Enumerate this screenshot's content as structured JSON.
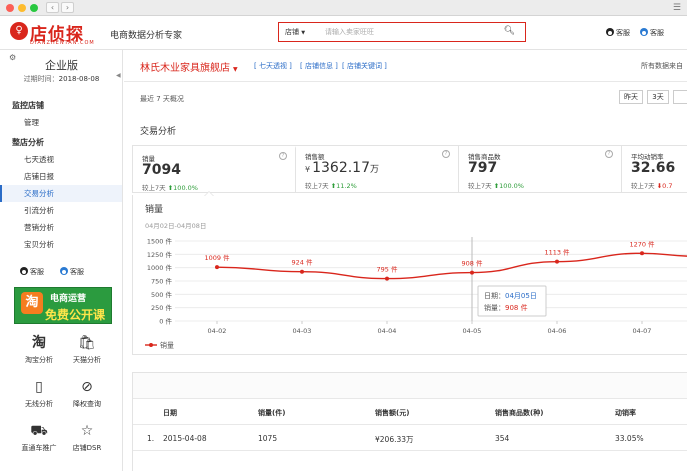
{
  "header": {
    "logo_text": "店侦探",
    "logo_sub": "DIANZHENTAN.COM",
    "slogan": "电商数据分析专家",
    "search_category": "店铺",
    "search_placeholder": "请输入卖家旺旺",
    "service_1": "客服",
    "service_2": "客服"
  },
  "sidebar": {
    "edition": "企业版",
    "expire_label": "过期时间：",
    "expire_date": "2018-08-08",
    "sections": [
      {
        "title": "监控店铺",
        "items": [
          "管理"
        ]
      },
      {
        "title": "整店分析",
        "items": [
          "七天透视",
          "店铺日报",
          "交易分析",
          "引流分析",
          "营销分析",
          "宝贝分析"
        ]
      }
    ],
    "active_item": "交易分析",
    "service_1": "客服",
    "service_2": "客服",
    "banner_line1": "电商运营",
    "banner_line2": "免费公开课",
    "banner_icon": "淘",
    "tools": [
      {
        "label": "淘宝分析",
        "icon": "taobao-icon"
      },
      {
        "label": "天猫分析",
        "icon": "tmall-icon"
      },
      {
        "label": "无线分析",
        "icon": "mobile-icon"
      },
      {
        "label": "降权查询",
        "icon": "ban-icon"
      },
      {
        "label": "直通车推广",
        "icon": "car-icon"
      },
      {
        "label": "店铺DSR",
        "icon": "star-icon"
      }
    ]
  },
  "main": {
    "shop_name": "林氏木业家具旗舰店",
    "links": [
      "[ 七天透视 ]",
      "[ 店铺信息 ]",
      "[ 店铺关键词 ]"
    ],
    "note": "所有数据来自",
    "overview": "最近 7 天概况",
    "range_buttons": [
      "昨天",
      "3天"
    ],
    "section_title": "交易分析"
  },
  "cards": [
    {
      "label": "销量",
      "prefix": "",
      "value": "7094",
      "unit": "",
      "cmp_label": "较上7天",
      "dir": "up",
      "cmp": "100.0%"
    },
    {
      "label": "销售额",
      "prefix": "¥",
      "value": "1362.17",
      "unit": "万",
      "cmp_label": "较上7天",
      "dir": "up",
      "cmp": "11.2%"
    },
    {
      "label": "销售商品数",
      "prefix": "",
      "value": "797",
      "unit": "",
      "cmp_label": "较上7天",
      "dir": "up",
      "cmp": "100.0%"
    },
    {
      "label": "平均动销率",
      "prefix": "",
      "value": "32.66",
      "unit": "",
      "cmp_label": "较上7天",
      "dir": "down",
      "cmp": "0.7"
    }
  ],
  "chart_data": {
    "type": "line",
    "title": "销量",
    "subtitle": "04月02日-04月08日",
    "categories": [
      "04-02",
      "04-03",
      "04-04",
      "04-05",
      "04-06",
      "04-07"
    ],
    "series": [
      {
        "name": "销量",
        "values": [
          1009,
          924,
          795,
          908,
          1113,
          1270
        ],
        "point_labels": [
          "1009 件",
          "924 件",
          "795 件",
          "908 件",
          "1113 件",
          "1270 件"
        ]
      }
    ],
    "ylim": [
      0,
      1500
    ],
    "yticks": [
      "0 件",
      "250 件",
      "500 件",
      "750 件",
      "1000 件",
      "1250 件",
      "1500 件"
    ],
    "ytick_values": [
      0,
      250,
      500,
      750,
      1000,
      1250,
      1500
    ],
    "grid": true,
    "legend": "bottom-left",
    "color": "#d9261c",
    "tooltip": {
      "date_label": "日期：",
      "date_value": "04月05日",
      "value_label": "销量：",
      "value_value": "908 件"
    }
  },
  "table": {
    "headers": [
      "日期",
      "销量(件)",
      "销售额(元)",
      "销售商品数(种)",
      "动销率"
    ],
    "rows": [
      {
        "index": "1.",
        "date": "2015-04-08",
        "sales": "1075",
        "amount": "¥206.33万",
        "items": "354",
        "rate": "33.05%"
      }
    ]
  },
  "colors": {
    "brand_red": "#d9261c",
    "link_blue": "#2a6cc7",
    "up_green": "#2e9d3a"
  }
}
